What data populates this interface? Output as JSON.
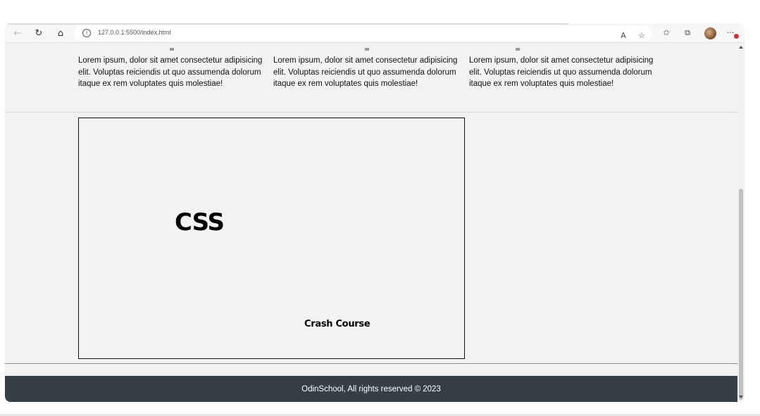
{
  "browser": {
    "url": "127.0.0.1:5500/index.html",
    "back_icon": "←",
    "reload_icon": "↻",
    "home_icon": "⌂",
    "info_icon": "i",
    "read_aloud_icon": "A",
    "favorite_icon": "☆",
    "favorites_icon": "✩",
    "collections_icon": "⧉",
    "menu_icon": "···"
  },
  "features": [
    {
      "text": "Lorem ipsum, dolor sit amet consectetur adipisicing elit. Voluptas reiciendis ut quo assumenda dolorum itaque ex rem voluptates quis molestiae!"
    },
    {
      "text": "Lorem ipsum, dolor sit amet consectetur adipisicing elit. Voluptas reiciendis ut quo assumenda dolorum itaque ex rem voluptates quis molestiae!"
    },
    {
      "text": "Lorem ipsum, dolor sit amet consectetur adipisicing elit. Voluptas reiciendis ut quo assumenda dolorum itaque ex rem voluptates quis molestiae!"
    }
  ],
  "hero": {
    "title": "CSS",
    "subtitle": "Crash Course"
  },
  "footer": {
    "text": "OdinSchool, All rights reserved © 2023"
  },
  "colors": {
    "footer_bg": "#353f45",
    "page_bg": "#f2f2f2",
    "notification_badge": "#d13438"
  }
}
